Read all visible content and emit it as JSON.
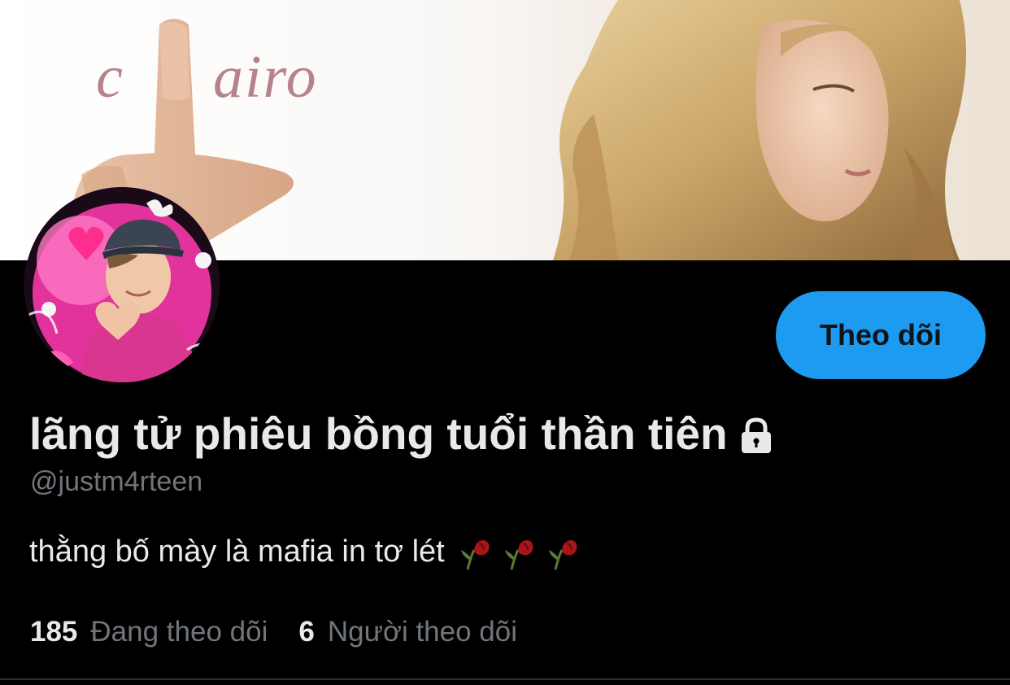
{
  "banner": {
    "text_left": "c",
    "text_right": "airo"
  },
  "profile": {
    "display_name": "lãng tử phiêu bồng tuổi thần tiên",
    "handle": "@justm4rteen",
    "bio": "thằng bố mày là mafia in tơ lét",
    "bio_emoji": [
      "wilted-rose-icon",
      "wilted-rose-icon",
      "wilted-rose-icon"
    ],
    "protected_icon": "lock-icon",
    "following_count": "185",
    "following_label": "Đang theo dõi",
    "followers_count": "6",
    "followers_label": "Người theo dõi"
  },
  "actions": {
    "follow_label": "Theo dõi"
  },
  "colors": {
    "background": "#000000",
    "primary_text": "#e7e9ea",
    "secondary_text": "#71767b",
    "accent": "#1d9bf0",
    "button_text": "#0f1419"
  }
}
